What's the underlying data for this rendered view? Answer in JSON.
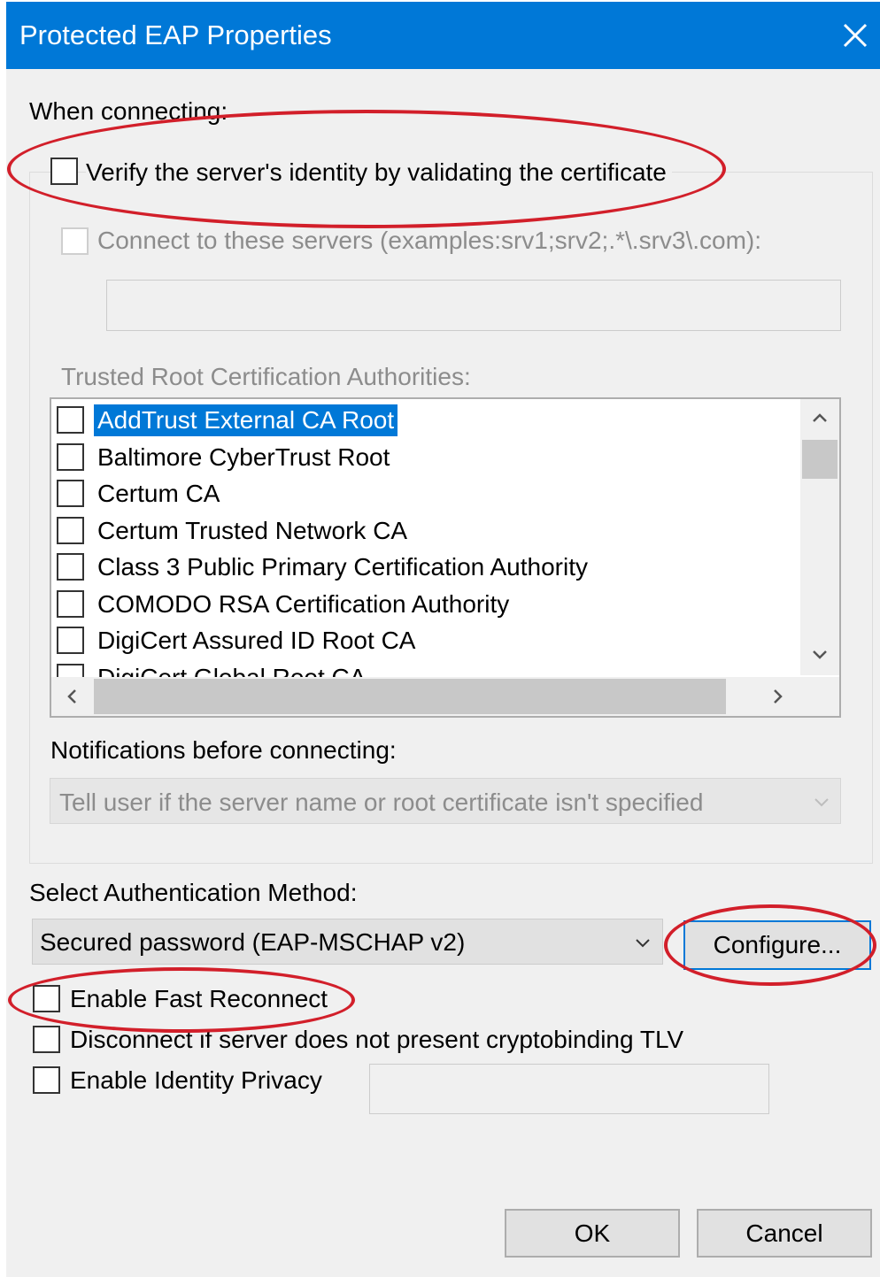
{
  "window": {
    "title": "Protected EAP Properties",
    "close_icon": "close-icon"
  },
  "connecting": {
    "heading": "When connecting:",
    "verify_label": "Verify the server's identity by validating the certificate",
    "verify_checked": false,
    "connect_servers_label": "Connect to these servers (examples:srv1;srv2;.*\\.srv3\\.com):",
    "servers_value": "",
    "trusted_root_label": "Trusted Root Certification Authorities:",
    "certificates": [
      {
        "label": "AddTrust External CA Root",
        "selected": true
      },
      {
        "label": "Baltimore CyberTrust Root"
      },
      {
        "label": "Certum CA"
      },
      {
        "label": "Certum Trusted Network CA"
      },
      {
        "label": "Class 3 Public Primary Certification Authority"
      },
      {
        "label": "COMODO RSA Certification Authority"
      },
      {
        "label": "DigiCert Assured ID Root CA"
      },
      {
        "label": "DigiCert Global Root CA"
      }
    ],
    "notifications_label": "Notifications before connecting:",
    "notifications_value": "Tell user if the server name or root certificate isn't specified"
  },
  "auth": {
    "label": "Select Authentication Method:",
    "method_value": "Secured password (EAP-MSCHAP v2)",
    "configure_label": "Configure...",
    "fast_reconnect_label": "Enable Fast Reconnect",
    "disconnect_label": "Disconnect if server does not present cryptobinding TLV",
    "identity_privacy_label": "Enable Identity Privacy",
    "identity_value": ""
  },
  "footer": {
    "ok_label": "OK",
    "cancel_label": "Cancel"
  },
  "colors": {
    "titlebar": "#0078d7",
    "annotation_circle": "#d21f2a",
    "selection": "#0078d7"
  }
}
